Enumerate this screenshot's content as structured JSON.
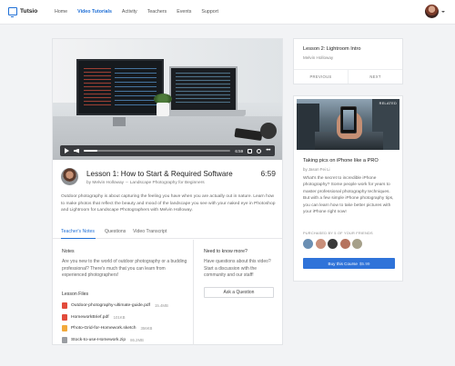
{
  "nav": {
    "brand": "Tutsio",
    "links": [
      "Home",
      "Video Tutorials",
      "Activity",
      "Teachers",
      "Events",
      "Support"
    ],
    "active_index": 1
  },
  "video": {
    "time": "6:59",
    "progress": 0.09
  },
  "lesson": {
    "title": "Lesson 1: How to Start & Required Software",
    "author": "Melvin Holloway",
    "course": "Landscape Photography for Beginners",
    "duration": "6:59"
  },
  "tabs": [
    {
      "label": "Teacher's Notes",
      "active": true
    },
    {
      "label": "Questions",
      "active": false
    },
    {
      "label": "Video Transcript",
      "active": false
    }
  ],
  "description": "Outdoor photography is about capturing the feeling you have when you are actually out in nature. Learn how to make photos that reflect the beauty and mood of the landscape you see with your naked eye in Photoshop and Lightroom for Landscape Photographers with Melvin Holloway.",
  "notes": {
    "heading": "Notes",
    "text": "Are you new to the world of outdoor photography or a budding professional? There's much that you can learn from experienced photographers!"
  },
  "files": {
    "heading": "Lesson Files",
    "items": [
      {
        "name": "Outdoor-photography-ultimate-guide.pdf",
        "size": "15.4MB",
        "color": "#e24b3b"
      },
      {
        "name": "HomeworkBrief.pdf",
        "size": "101KB",
        "color": "#e24b3b"
      },
      {
        "name": "Photo-Grid-for-Homework.sketch",
        "size": "356KB",
        "color": "#f2a93b"
      },
      {
        "name": "Stock-to-use-Homework.zip",
        "size": "86.2MB",
        "color": "#9a9da2"
      }
    ]
  },
  "help": {
    "heading": "Need to know more?",
    "text": "Have questions about this video? Start a discussion with the community and our staff!",
    "button": "Ask a Question"
  },
  "next_lesson": {
    "title": "Lesson 2: Lightroom Intro",
    "author": "Melvin Holloway",
    "prev_label": "PREVIOUS",
    "next_label": "NEXT"
  },
  "promo": {
    "badge": "RELATED",
    "title": "Taking pics on iPhone like a PRO",
    "author": "by Jason Fei Li",
    "description": "What's the secret to incredible iPhone photography? Some people work for years to master professional photography techniques. But with a few simple iPhone photography tips, you can learn how to take better pictures with your iPhone right now!",
    "friends_label": "PURCHASED BY 5 OF YOUR FRIENDS",
    "friend_colors": [
      "#6b8fb3",
      "#c98f7a",
      "#3a3a3a",
      "#b5735e",
      "#a6a08a"
    ],
    "buy_label": "Buy this Course",
    "price": "$5.99"
  },
  "colors": {
    "accent": "#1f6fd6",
    "button": "#2f73d9"
  }
}
